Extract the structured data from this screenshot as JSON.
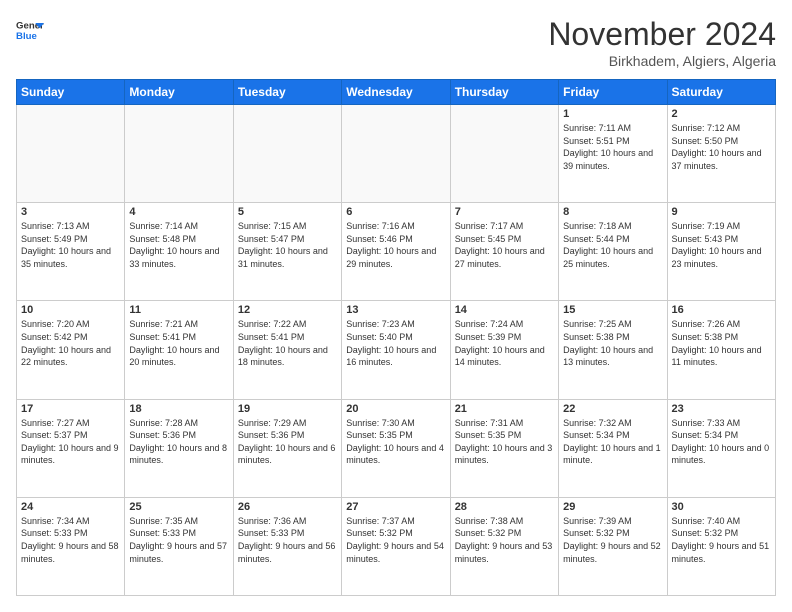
{
  "header": {
    "logo_line1": "General",
    "logo_line2": "Blue",
    "month": "November 2024",
    "location": "Birkhadem, Algiers, Algeria"
  },
  "weekdays": [
    "Sunday",
    "Monday",
    "Tuesday",
    "Wednesday",
    "Thursday",
    "Friday",
    "Saturday"
  ],
  "weeks": [
    [
      {
        "day": "",
        "info": ""
      },
      {
        "day": "",
        "info": ""
      },
      {
        "day": "",
        "info": ""
      },
      {
        "day": "",
        "info": ""
      },
      {
        "day": "",
        "info": ""
      },
      {
        "day": "1",
        "info": "Sunrise: 7:11 AM\nSunset: 5:51 PM\nDaylight: 10 hours and 39 minutes."
      },
      {
        "day": "2",
        "info": "Sunrise: 7:12 AM\nSunset: 5:50 PM\nDaylight: 10 hours and 37 minutes."
      }
    ],
    [
      {
        "day": "3",
        "info": "Sunrise: 7:13 AM\nSunset: 5:49 PM\nDaylight: 10 hours and 35 minutes."
      },
      {
        "day": "4",
        "info": "Sunrise: 7:14 AM\nSunset: 5:48 PM\nDaylight: 10 hours and 33 minutes."
      },
      {
        "day": "5",
        "info": "Sunrise: 7:15 AM\nSunset: 5:47 PM\nDaylight: 10 hours and 31 minutes."
      },
      {
        "day": "6",
        "info": "Sunrise: 7:16 AM\nSunset: 5:46 PM\nDaylight: 10 hours and 29 minutes."
      },
      {
        "day": "7",
        "info": "Sunrise: 7:17 AM\nSunset: 5:45 PM\nDaylight: 10 hours and 27 minutes."
      },
      {
        "day": "8",
        "info": "Sunrise: 7:18 AM\nSunset: 5:44 PM\nDaylight: 10 hours and 25 minutes."
      },
      {
        "day": "9",
        "info": "Sunrise: 7:19 AM\nSunset: 5:43 PM\nDaylight: 10 hours and 23 minutes."
      }
    ],
    [
      {
        "day": "10",
        "info": "Sunrise: 7:20 AM\nSunset: 5:42 PM\nDaylight: 10 hours and 22 minutes."
      },
      {
        "day": "11",
        "info": "Sunrise: 7:21 AM\nSunset: 5:41 PM\nDaylight: 10 hours and 20 minutes."
      },
      {
        "day": "12",
        "info": "Sunrise: 7:22 AM\nSunset: 5:41 PM\nDaylight: 10 hours and 18 minutes."
      },
      {
        "day": "13",
        "info": "Sunrise: 7:23 AM\nSunset: 5:40 PM\nDaylight: 10 hours and 16 minutes."
      },
      {
        "day": "14",
        "info": "Sunrise: 7:24 AM\nSunset: 5:39 PM\nDaylight: 10 hours and 14 minutes."
      },
      {
        "day": "15",
        "info": "Sunrise: 7:25 AM\nSunset: 5:38 PM\nDaylight: 10 hours and 13 minutes."
      },
      {
        "day": "16",
        "info": "Sunrise: 7:26 AM\nSunset: 5:38 PM\nDaylight: 10 hours and 11 minutes."
      }
    ],
    [
      {
        "day": "17",
        "info": "Sunrise: 7:27 AM\nSunset: 5:37 PM\nDaylight: 10 hours and 9 minutes."
      },
      {
        "day": "18",
        "info": "Sunrise: 7:28 AM\nSunset: 5:36 PM\nDaylight: 10 hours and 8 minutes."
      },
      {
        "day": "19",
        "info": "Sunrise: 7:29 AM\nSunset: 5:36 PM\nDaylight: 10 hours and 6 minutes."
      },
      {
        "day": "20",
        "info": "Sunrise: 7:30 AM\nSunset: 5:35 PM\nDaylight: 10 hours and 4 minutes."
      },
      {
        "day": "21",
        "info": "Sunrise: 7:31 AM\nSunset: 5:35 PM\nDaylight: 10 hours and 3 minutes."
      },
      {
        "day": "22",
        "info": "Sunrise: 7:32 AM\nSunset: 5:34 PM\nDaylight: 10 hours and 1 minute."
      },
      {
        "day": "23",
        "info": "Sunrise: 7:33 AM\nSunset: 5:34 PM\nDaylight: 10 hours and 0 minutes."
      }
    ],
    [
      {
        "day": "24",
        "info": "Sunrise: 7:34 AM\nSunset: 5:33 PM\nDaylight: 9 hours and 58 minutes."
      },
      {
        "day": "25",
        "info": "Sunrise: 7:35 AM\nSunset: 5:33 PM\nDaylight: 9 hours and 57 minutes."
      },
      {
        "day": "26",
        "info": "Sunrise: 7:36 AM\nSunset: 5:33 PM\nDaylight: 9 hours and 56 minutes."
      },
      {
        "day": "27",
        "info": "Sunrise: 7:37 AM\nSunset: 5:32 PM\nDaylight: 9 hours and 54 minutes."
      },
      {
        "day": "28",
        "info": "Sunrise: 7:38 AM\nSunset: 5:32 PM\nDaylight: 9 hours and 53 minutes."
      },
      {
        "day": "29",
        "info": "Sunrise: 7:39 AM\nSunset: 5:32 PM\nDaylight: 9 hours and 52 minutes."
      },
      {
        "day": "30",
        "info": "Sunrise: 7:40 AM\nSunset: 5:32 PM\nDaylight: 9 hours and 51 minutes."
      }
    ]
  ]
}
